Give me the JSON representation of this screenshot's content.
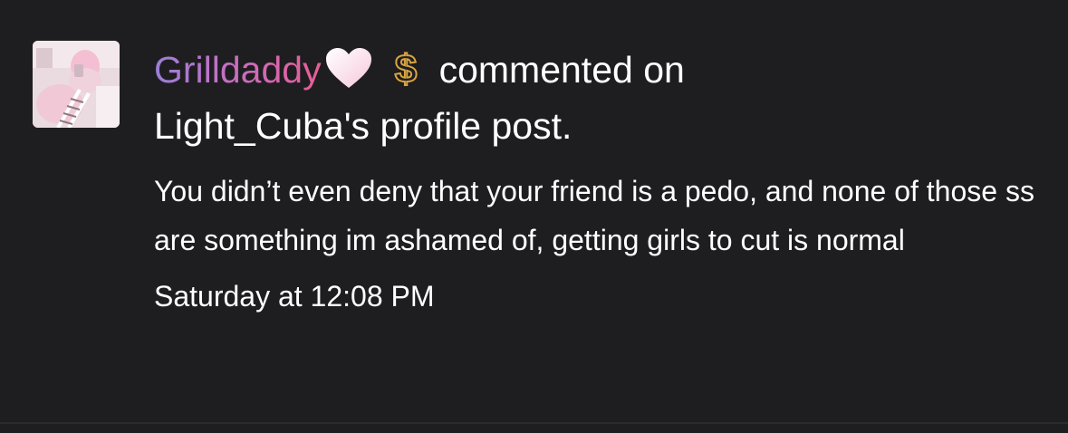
{
  "notification": {
    "username": "Grilldaddy",
    "action_text": "commented on",
    "target_text": "Light_Cuba's profile post.",
    "comment_text": "You didn’t even deny that your friend is a pedo, and none of those ss are something im ashamed of, getting girls to cut is normal",
    "timestamp": "Saturday at 12:08 PM",
    "icons": [
      "avatar",
      "white-heart-icon",
      "gold-dollar-icon"
    ],
    "colors": {
      "background": "#1e1e20",
      "text": "#ffffff",
      "username_gradient_start": "#9b7fd6",
      "username_gradient_end": "#e75d95",
      "dollar_gold": "#d9a441"
    }
  }
}
